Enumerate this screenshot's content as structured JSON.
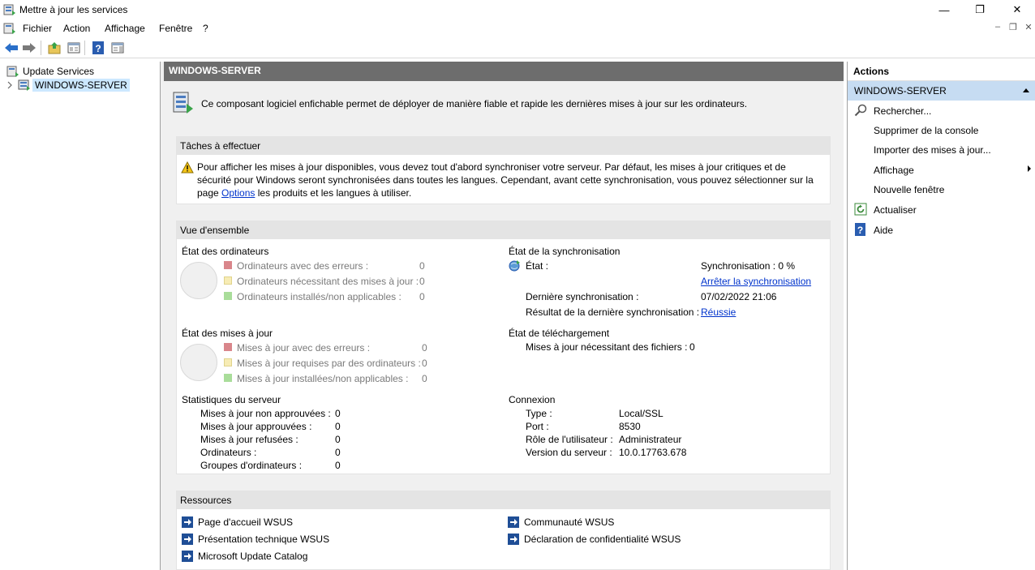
{
  "window": {
    "title": "Mettre à jour les services",
    "controls": {
      "minimize": "—",
      "restore": "❐",
      "close": "✕"
    }
  },
  "menubar": {
    "items": [
      "Fichier",
      "Action",
      "Affichage",
      "Fenêtre",
      "?"
    ],
    "mdi": {
      "minimize": "–",
      "restore": "❐",
      "close": "✕"
    }
  },
  "tree": {
    "root_label": "Update Services",
    "child_label": "WINDOWS-SERVER"
  },
  "center": {
    "header": "WINDOWS-SERVER",
    "intro": "Ce composant logiciel enfichable permet de déployer de manière fiable et rapide les dernières mises à jour sur les ordinateurs.",
    "tasks": {
      "title": "Tâches à effectuer",
      "text_before": "Pour afficher les mises à jour disponibles, vous devez tout d'abord synchroniser votre serveur. Par défaut, les mises à jour critiques et de sécurité pour Windows seront synchronisées dans toutes les langues. Cependant, avant cette synchronisation, vous pouvez sélectionner sur la page ",
      "link": "Options",
      "text_after": " les produits et les langues à utiliser."
    },
    "overview": {
      "title": "Vue d'ensemble",
      "computers": {
        "title": "État des ordinateurs",
        "rows": [
          {
            "label": "Ordinateurs avec des erreurs :",
            "value": "0"
          },
          {
            "label": "Ordinateurs nécessitant des mises à jour :",
            "value": "0"
          },
          {
            "label": "Ordinateurs installés/non applicables :",
            "value": "0"
          }
        ]
      },
      "updates": {
        "title": "État des mises à jour",
        "rows": [
          {
            "label": "Mises à jour avec des erreurs :",
            "value": "0"
          },
          {
            "label": "Mises à jour requises par des ordinateurs :",
            "value": "0"
          },
          {
            "label": "Mises à jour installées/non applicables :",
            "value": "0"
          }
        ]
      },
      "sync": {
        "title": "État de la synchronisation",
        "state_label": "État :",
        "state_value": "Synchronisation : 0 %",
        "stop_link": "Arrêter la synchronisation",
        "last_label": "Dernière synchronisation :",
        "last_value": "07/02/2022 21:06",
        "result_label": "Résultat de la dernière synchronisation :",
        "result_link": "Réussie"
      },
      "download": {
        "title": "État de téléchargement",
        "label": "Mises à jour nécessitant des fichiers :",
        "value": "0"
      },
      "stats": {
        "title": "Statistiques du serveur",
        "rows": [
          {
            "label": "Mises à jour non approuvées :",
            "value": "0"
          },
          {
            "label": "Mises à jour approuvées :",
            "value": "0"
          },
          {
            "label": "Mises à jour refusées :",
            "value": "0"
          },
          {
            "label": "Ordinateurs :",
            "value": "0"
          },
          {
            "label": "Groupes d'ordinateurs :",
            "value": "0"
          }
        ]
      },
      "connection": {
        "title": "Connexion",
        "rows": [
          {
            "label": "Type :",
            "value": "Local/SSL"
          },
          {
            "label": "Port :",
            "value": "8530"
          },
          {
            "label": "Rôle de l'utilisateur :",
            "value": "Administrateur"
          },
          {
            "label": "Version du serveur :",
            "value": "10.0.17763.678"
          }
        ]
      }
    },
    "resources": {
      "title": "Ressources",
      "left": [
        "Page d'accueil WSUS",
        "Présentation technique WSUS",
        "Microsoft Update Catalog"
      ],
      "right": [
        "Communauté WSUS",
        "Déclaration de confidentialité WSUS"
      ]
    }
  },
  "actions": {
    "title": "Actions",
    "group": "WINDOWS-SERVER",
    "items": [
      {
        "label": "Rechercher...",
        "icon": "search-icon"
      },
      {
        "label": "Supprimer de la console",
        "icon": ""
      },
      {
        "label": "Importer des mises à jour...",
        "icon": ""
      },
      {
        "label": "Affichage",
        "icon": ""
      },
      {
        "label": "Nouvelle fenêtre",
        "icon": ""
      },
      {
        "label": "Actualiser",
        "icon": "refresh-icon"
      },
      {
        "label": "Aide",
        "icon": "help-icon"
      }
    ]
  },
  "colors": {
    "error": "#d9868b",
    "needed": "#f7ecb5",
    "installed": "#a9dd9a",
    "link": "#0033cc",
    "header": "#6d6d6d",
    "selection": "#cce8ff",
    "actions_group": "#c6dcf2"
  }
}
